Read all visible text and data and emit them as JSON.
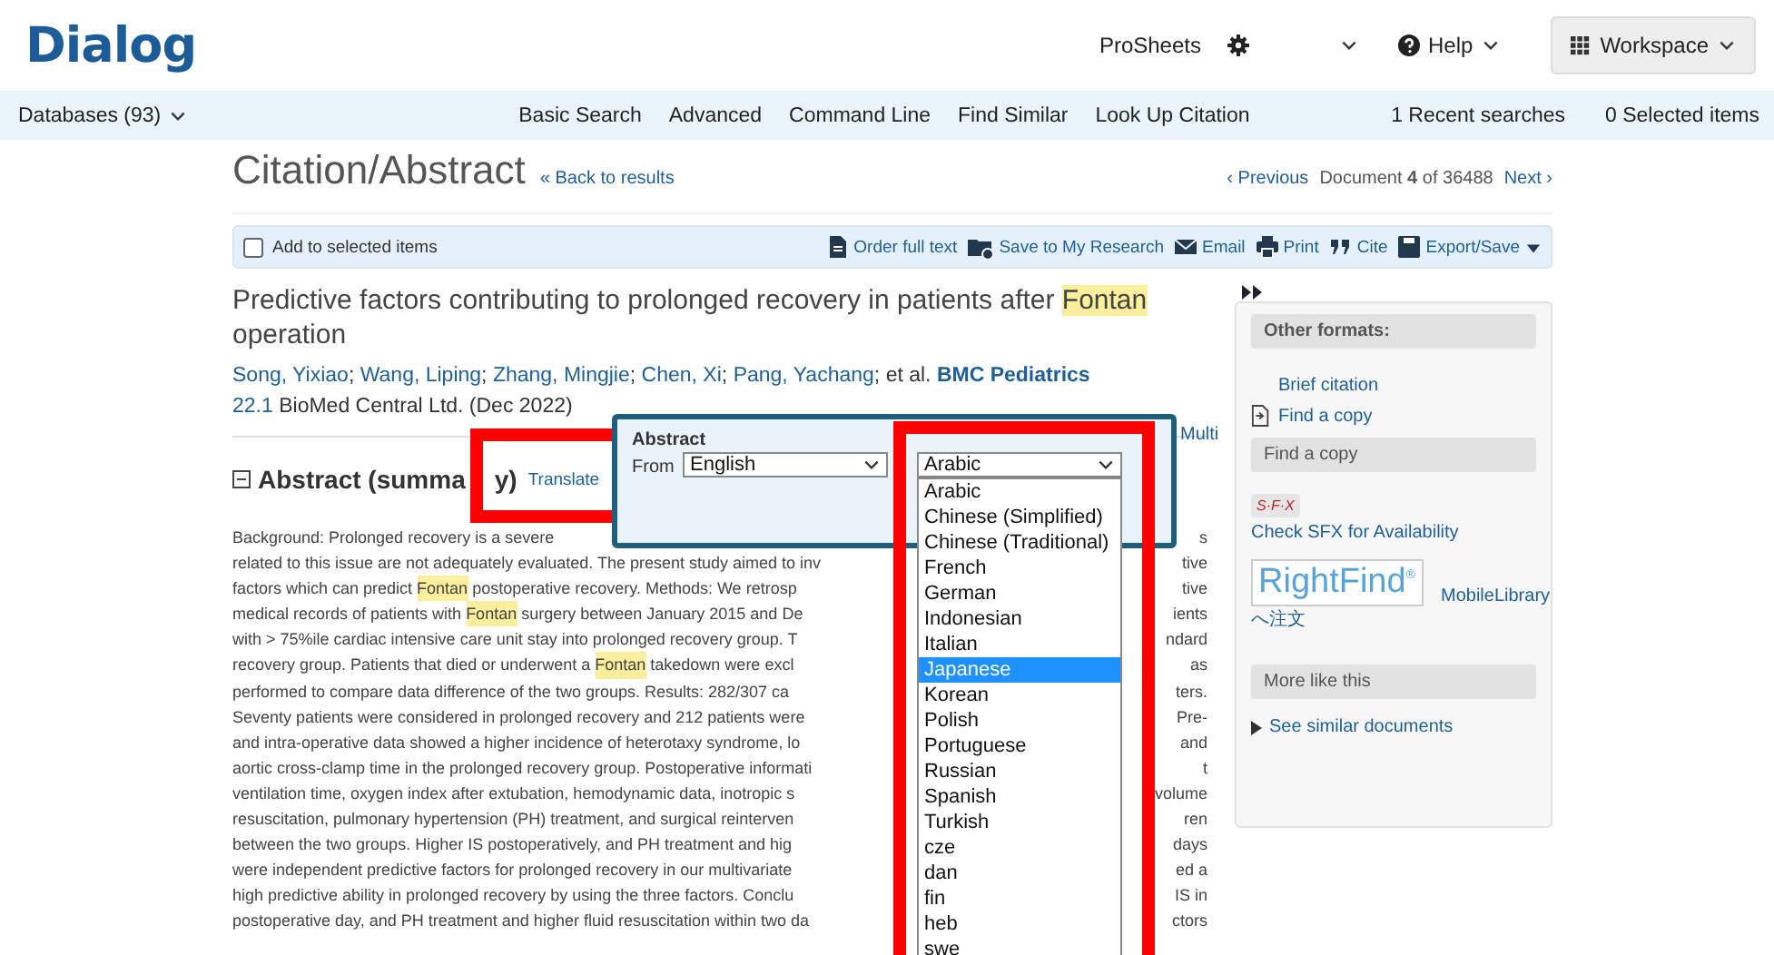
{
  "header": {
    "logo": "Dialog",
    "prosheets": "ProSheets",
    "help": "Help",
    "workspace": "Workspace"
  },
  "nav": {
    "databases": "Databases (93)",
    "links": [
      "Basic Search",
      "Advanced",
      "Command Line",
      "Find Similar",
      "Look Up Citation"
    ],
    "recent": "1 Recent searches",
    "selected": "0 Selected items"
  },
  "page": {
    "title": "Citation/Abstract",
    "back": "« Back to results",
    "previous": "‹ Previous",
    "document": "Document **4** of 36488",
    "next": "Next ›"
  },
  "toolbar": {
    "add_checkbox": {
      "label": "Add to selected items",
      "checked": false
    },
    "actions": [
      {
        "kind": "order",
        "label": "Order full text"
      },
      {
        "kind": "save",
        "label": "Save to My Research"
      },
      {
        "kind": "email",
        "label": "Email"
      },
      {
        "kind": "print",
        "label": "Print"
      },
      {
        "kind": "cite",
        "label": "Cite"
      },
      {
        "kind": "export",
        "label": "Export/Save"
      }
    ]
  },
  "article": {
    "title": [
      {
        "text": "Predictive factors contributing to prolonged recovery in patients after ",
        "highlighted": false
      },
      {
        "text": "Fontan",
        "highlighted": true
      },
      {
        "text": " operation",
        "highlighted": false
      }
    ],
    "authors": [
      {
        "name": "Song, Yixiao",
        "separator": ";"
      },
      {
        "name": "Wang, Liping",
        "separator": ";"
      },
      {
        "name": "Zhang, Mingjie",
        "separator": ";"
      },
      {
        "name": "Chen, Xi",
        "separator": ";"
      },
      {
        "name": "Pang, Yachang",
        "separator": ";"
      }
    ],
    "et_al": "et al.",
    "journal": "BMC Pediatrics",
    "issue": "22.1",
    "publisher": "BioMed Central Ltd. (Dec 2022)"
  },
  "abstract": {
    "heading": "Abstract (summa",
    "heading_tail": "y)",
    "expanded": true,
    "translate": "Translate",
    "multi": "Multi",
    "lines": [
      {
        "left": [
          {
            "text": "Background: Prolonged recovery is a severe",
            "highlighted": false
          }
        ],
        "right": "s"
      },
      {
        "left": [
          {
            "text": "related to this issue are not adequately evaluated. The present study aimed to inv",
            "highlighted": false
          }
        ],
        "right": "tive"
      },
      {
        "left": [
          {
            "text": "factors which can predict ",
            "highlighted": false
          },
          {
            "text": "Fontan",
            "highlighted": true
          },
          {
            "text": " postoperative recovery. Methods: We retrosp",
            "highlighted": false
          }
        ],
        "right": "tive"
      },
      {
        "left": [
          {
            "text": "medical records of patients with ",
            "highlighted": false
          },
          {
            "text": "Fontan",
            "highlighted": true
          },
          {
            "text": " surgery between January 2015 and De",
            "highlighted": false
          }
        ],
        "right": "ients"
      },
      {
        "left": [
          {
            "text": "with > 75%ile cardiac intensive care unit stay into prolonged recovery group. T",
            "highlighted": false
          }
        ],
        "right": "ndard"
      },
      {
        "left": [
          {
            "text": "recovery group. Patients that died or underwent a ",
            "highlighted": false
          },
          {
            "text": "Fontan",
            "highlighted": true
          },
          {
            "text": " takedown were excl",
            "highlighted": false
          }
        ],
        "right": "as"
      },
      {
        "left": [
          {
            "text": "performed to compare data difference of the two groups. Results: 282/307 ca",
            "highlighted": false
          }
        ],
        "right": "ters."
      },
      {
        "left": [
          {
            "text": "Seventy patients were considered in prolonged recovery and 212 patients were",
            "highlighted": false
          }
        ],
        "right": "Pre-"
      },
      {
        "left": [
          {
            "text": "and intra-operative data showed a higher incidence of heterotaxy syndrome, lo",
            "highlighted": false
          }
        ],
        "right": "and"
      },
      {
        "left": [
          {
            "text": "aortic cross-clamp time in the prolonged recovery group. Postoperative informati",
            "highlighted": false
          }
        ],
        "right": "t"
      },
      {
        "left": [
          {
            "text": "ventilation time, oxygen index after extubation, hemodynamic data, inotropic s",
            "highlighted": false
          }
        ],
        "right": "volume"
      },
      {
        "left": [
          {
            "text": "resuscitation, pulmonary hypertension (PH) treatment, and surgical reinterven",
            "highlighted": false
          }
        ],
        "right": "ren"
      },
      {
        "left": [
          {
            "text": "between the two groups. Higher IS postoperatively, and PH treatment and hig",
            "highlighted": false
          }
        ],
        "right": "days"
      },
      {
        "left": [
          {
            "text": "were independent predictive factors for prolonged recovery in our multivariate",
            "highlighted": false
          }
        ],
        "right": "ed a"
      },
      {
        "left": [
          {
            "text": "high predictive ability in prolonged recovery by using the three factors. Conclu",
            "highlighted": false
          }
        ],
        "right": "IS in"
      },
      {
        "left": [
          {
            "text": "postoperative day, and PH treatment and higher fluid resuscitation within two da",
            "highlighted": false
          }
        ],
        "right": "ctors"
      }
    ]
  },
  "translate_popup": {
    "title": "Abstract",
    "from_label": "From",
    "from_value": "English",
    "to_value": "Arabic",
    "options": [
      {
        "label": "Arabic",
        "selected": false
      },
      {
        "label": "Chinese (Simplified)",
        "selected": false
      },
      {
        "label": "Chinese (Traditional)",
        "selected": false
      },
      {
        "label": "French",
        "selected": false
      },
      {
        "label": "German",
        "selected": false
      },
      {
        "label": "Indonesian",
        "selected": false
      },
      {
        "label": "Italian",
        "selected": false
      },
      {
        "label": "Japanese",
        "selected": true
      },
      {
        "label": "Korean",
        "selected": false
      },
      {
        "label": "Polish",
        "selected": false
      },
      {
        "label": "Portuguese",
        "selected": false
      },
      {
        "label": "Russian",
        "selected": false
      },
      {
        "label": "Spanish",
        "selected": false
      },
      {
        "label": "Turkish",
        "selected": false
      },
      {
        "label": "cze",
        "selected": false
      },
      {
        "label": "dan",
        "selected": false
      },
      {
        "label": "fin",
        "selected": false
      },
      {
        "label": "heb",
        "selected": false
      },
      {
        "label": "swe",
        "selected": false
      }
    ]
  },
  "sidebar": {
    "other_formats": {
      "heading": "Other formats:",
      "links": [
        {
          "kind": "plain",
          "label": "Brief citation"
        },
        {
          "kind": "document",
          "label": "Find a copy"
        }
      ]
    },
    "find_copy": {
      "heading": "Find a copy",
      "sfx_logo": "S·F·X",
      "sfx_link": "Check SFX for Availability",
      "rightfind": "RightFind$^{®}$",
      "mobile": "MobileLibrary",
      "order": "へ注文"
    },
    "more": {
      "heading": "More like this",
      "link": "See similar documents"
    }
  }
}
